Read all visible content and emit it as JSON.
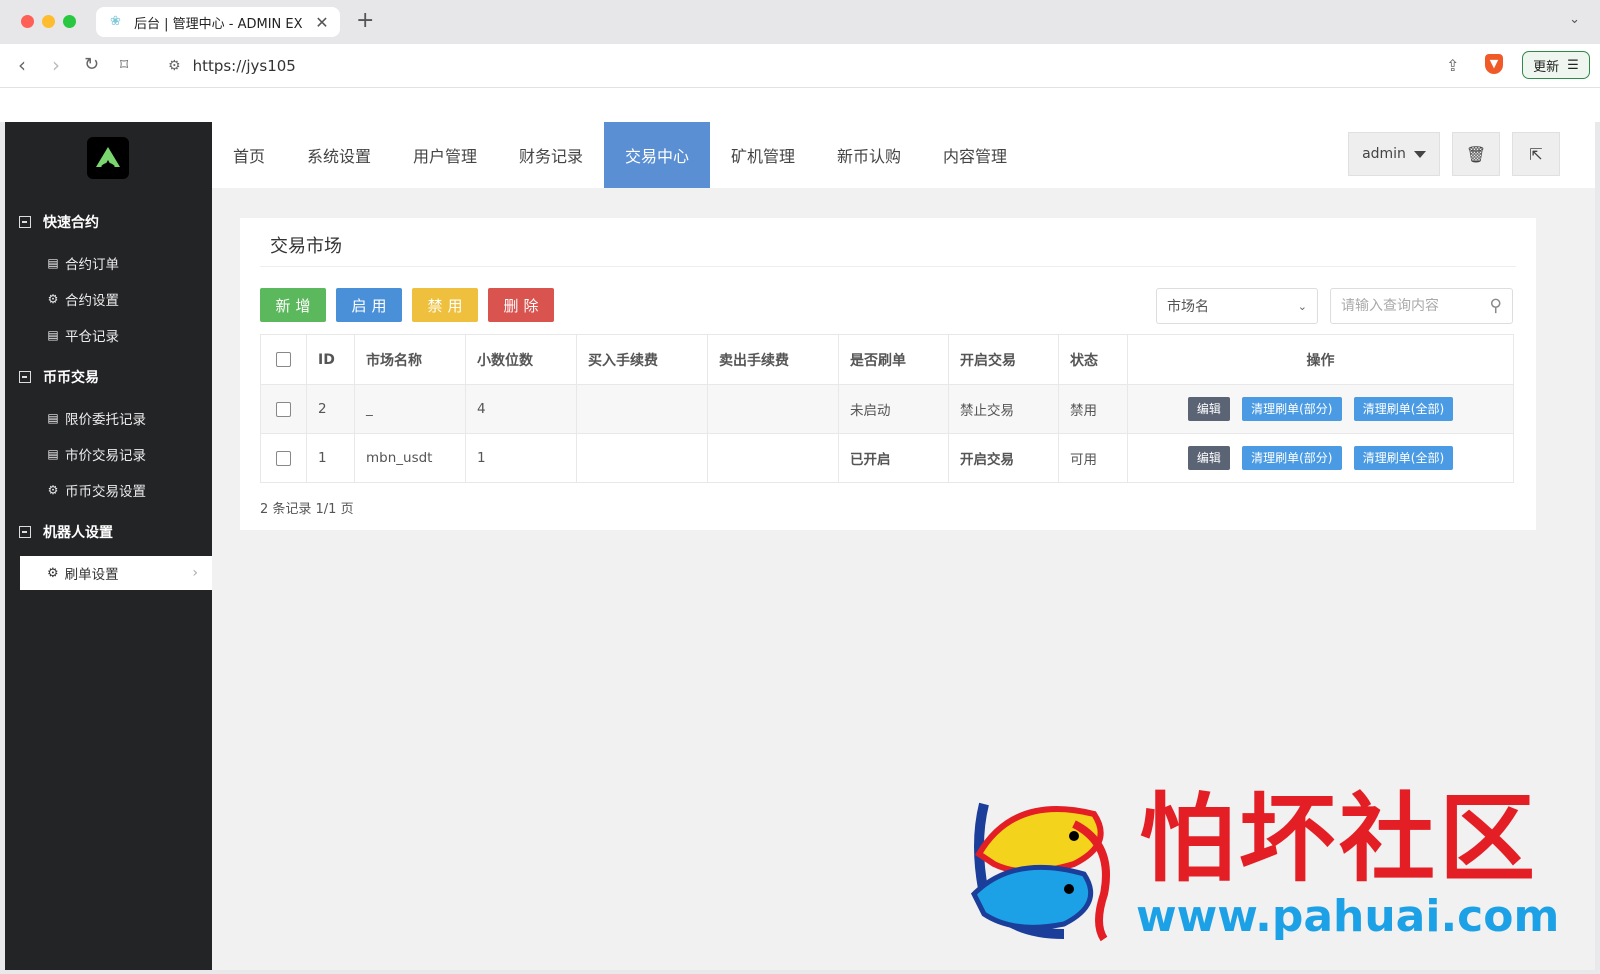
{
  "browser": {
    "tab_title": "后台 | 管理中心 - ADMIN EX",
    "url": "https://jys105",
    "update_label": "更新"
  },
  "sidebar": {
    "groups": [
      {
        "label": "快速合约",
        "items": [
          {
            "label": "合约订单",
            "icon": "list-icon"
          },
          {
            "label": "合约设置",
            "icon": "gear-icon"
          },
          {
            "label": "平仓记录",
            "icon": "list-icon"
          }
        ]
      },
      {
        "label": "币币交易",
        "items": [
          {
            "label": "限价委托记录",
            "icon": "list-icon"
          },
          {
            "label": "市价交易记录",
            "icon": "list-icon"
          },
          {
            "label": "币币交易设置",
            "icon": "gear-icon"
          }
        ]
      },
      {
        "label": "机器人设置",
        "items": [
          {
            "label": "刷单设置",
            "icon": "gear-icon"
          }
        ]
      }
    ]
  },
  "topnav": {
    "items": [
      "首页",
      "系统设置",
      "用户管理",
      "财务记录",
      "交易中心",
      "矿机管理",
      "新币认购",
      "内容管理"
    ],
    "active": "交易中心",
    "user": "admin"
  },
  "panel": {
    "title": "交易市场",
    "buttons": {
      "add": "新增",
      "enable": "启用",
      "disable": "禁用",
      "delete": "删除"
    },
    "select_value": "市场名",
    "search_placeholder": "请输入查询内容",
    "columns": [
      "ID",
      "市场名称",
      "小数位数",
      "买入手续费",
      "卖出手续费",
      "是否刷单",
      "开启交易",
      "状态",
      "操作"
    ],
    "rows": [
      {
        "id": "2",
        "name": "_",
        "decimals": "4",
        "buy_fee": "",
        "sell_fee": "",
        "brush": "未启动",
        "trade": "禁止交易",
        "status": "禁用"
      },
      {
        "id": "1",
        "name": "mbn_usdt",
        "decimals": "1",
        "buy_fee": "",
        "sell_fee": "",
        "brush": "已开启",
        "trade": "开启交易",
        "status": "可用"
      }
    ],
    "ops": {
      "edit": "编辑",
      "clear_part": "清理刷单(部分)",
      "clear_all": "清理刷单(全部)"
    },
    "pager": "2 条记录 1/1 页"
  },
  "watermark": {
    "text": "怕坏社区",
    "url": "www.pahuai.com"
  },
  "colors": {
    "sidebar_bg": "#232426",
    "nav_active": "#5b8fd3",
    "btn_add": "#5cb85c",
    "btn_enable": "#4a90d9",
    "btn_disable": "#eec03d",
    "btn_delete": "#d9534f",
    "status_ok": "#3a8c2a"
  }
}
